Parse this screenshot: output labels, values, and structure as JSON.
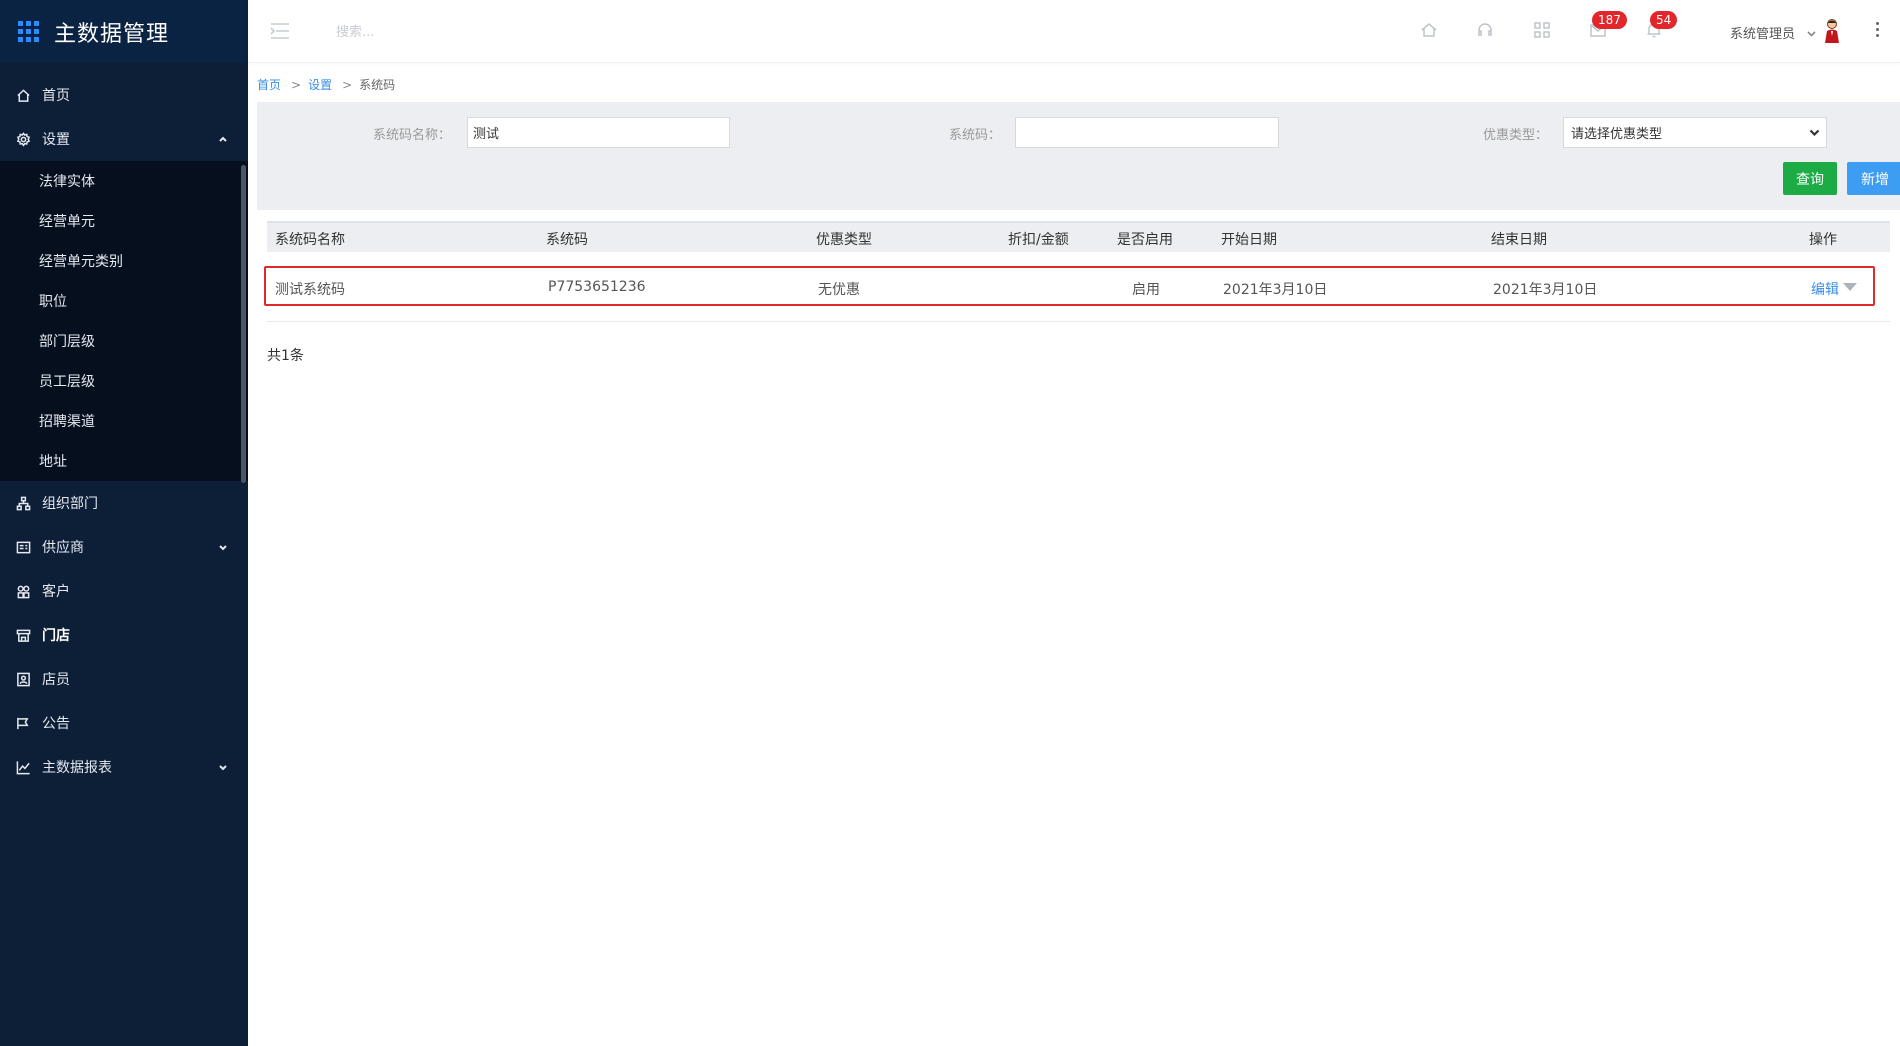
{
  "app": {
    "title": "主数据管理"
  },
  "sidebar": {
    "items": [
      {
        "label": "首页",
        "icon": "home-icon"
      },
      {
        "label": "设置",
        "icon": "gear-icon",
        "expanded": true
      },
      {
        "label": "组织部门",
        "icon": "org-chart-icon"
      },
      {
        "label": "供应商",
        "icon": "supplier-icon"
      },
      {
        "label": "客户",
        "icon": "customer-icon"
      },
      {
        "label": "门店",
        "icon": "store-icon",
        "active": true
      },
      {
        "label": "店员",
        "icon": "clerk-icon"
      },
      {
        "label": "公告",
        "icon": "announcement-icon"
      },
      {
        "label": "主数据报表",
        "icon": "chart-icon"
      }
    ],
    "settings_sub": [
      "法律实体",
      "经营单元",
      "经营单元类别",
      "职位",
      "部门层级",
      "员工层级",
      "招聘渠道",
      "地址"
    ]
  },
  "header": {
    "search_placeholder": "搜索...",
    "message_badge": "187",
    "notice_badge": "54",
    "user_name": "系统管理员"
  },
  "breadcrumb": {
    "home": "首页",
    "sep": ">",
    "settings": "设置",
    "current": "系统码"
  },
  "filter": {
    "name_label": "系统码名称：",
    "name_value": "测试",
    "code_label": "系统码：",
    "code_value": "",
    "type_label": "优惠类型：",
    "type_selected": "请选择优惠类型",
    "query_button": "查询",
    "add_button": "新增"
  },
  "table": {
    "columns": [
      "系统码名称",
      "系统码",
      "优惠类型",
      "折扣/金额",
      "是否启用",
      "开始日期",
      "结束日期",
      "操作"
    ],
    "rows": [
      {
        "name": "测试系统码",
        "code": "P7753651236",
        "type": "无优惠",
        "amount": "",
        "enabled": "启用",
        "start": "2021年3月10日",
        "end": "2021年3月10日",
        "action": "编辑"
      }
    ],
    "total": "共1条"
  },
  "colors": {
    "sidebar_bg": "#0d1e37",
    "accent_blue": "#3c9df2",
    "query_green": "#1cab44",
    "badge_red": "#e3262b",
    "highlight_red": "#e02a2a"
  }
}
